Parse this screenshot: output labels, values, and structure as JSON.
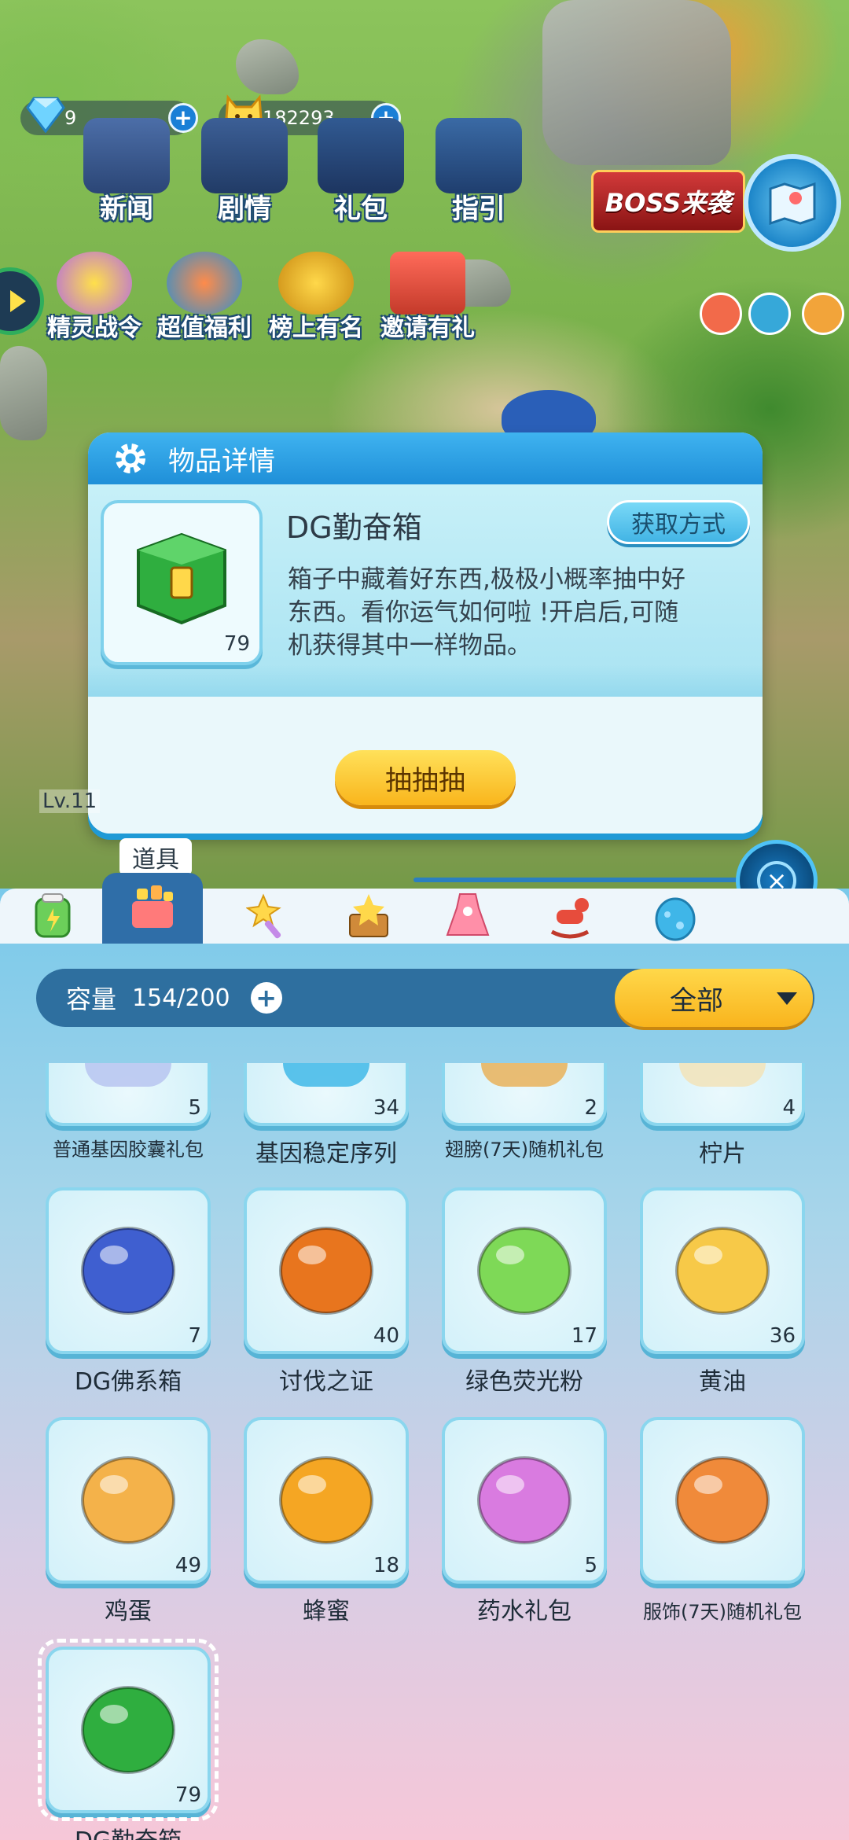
{
  "currency": {
    "gems": "9",
    "coins": "182293",
    "plus": "+"
  },
  "top_menu": [
    {
      "label": "新闻"
    },
    {
      "label": "剧情"
    },
    {
      "label": "礼包"
    },
    {
      "label": "指引"
    }
  ],
  "second_menu": [
    {
      "label": "精灵战令"
    },
    {
      "label": "超值福利"
    },
    {
      "label": "榜上有名"
    },
    {
      "label": "邀请有礼"
    }
  ],
  "boss_banner": "BOSS来袭",
  "dialog": {
    "title": "物品详情",
    "item_name": "DG勤奋箱",
    "item_count": "79",
    "get_button": "获取方式",
    "description": "箱子中藏着好东西,极极小概率抽中好东西。看你运气如何啦 !开启后,可随机获得其中一样物品。",
    "action_button": "抽抽抽"
  },
  "level_tag": "Lv.11",
  "tab_tooltip": "道具",
  "close_icon": "×",
  "bag": {
    "capacity_label": "容量",
    "capacity_value": "154/200",
    "capacity_plus": "+",
    "filter_label": "全部",
    "rows": [
      [
        {
          "name": "普通基因胶囊礼包",
          "count": "5",
          "icon": "gene-capsule-gift-icon",
          "color": "#b7c4f0"
        },
        {
          "name": "基因稳定序列",
          "count": "34",
          "icon": "gene-sequence-icon",
          "color": "#41b8e8"
        },
        {
          "name": "翅膀(7天)随机礼包",
          "count": "2",
          "icon": "wing-gift-icon",
          "color": "#e9b25a"
        },
        {
          "name": "柠片",
          "count": "4",
          "icon": "lemon-slice-icon",
          "color": "#f2e3b8"
        }
      ],
      [
        {
          "name": "DG佛系箱",
          "count": "7",
          "icon": "blue-chest-icon",
          "color": "#3f5fd0"
        },
        {
          "name": "讨伐之证",
          "count": "40",
          "icon": "fire-eye-icon",
          "color": "#e8751e"
        },
        {
          "name": "绿色荧光粉",
          "count": "17",
          "icon": "green-powder-bowl-icon",
          "color": "#7ed957"
        },
        {
          "name": "黄油",
          "count": "36",
          "icon": "cheese-icon",
          "color": "#f7c948"
        }
      ],
      [
        {
          "name": "鸡蛋",
          "count": "49",
          "icon": "egg-icon",
          "color": "#f4b24a"
        },
        {
          "name": "蜂蜜",
          "count": "18",
          "icon": "honeycomb-icon",
          "color": "#f5a623"
        },
        {
          "name": "药水礼包",
          "count": "5",
          "icon": "potion-gift-icon",
          "color": "#d97be0"
        },
        {
          "name": "服饰(7天)随机礼包",
          "count": "",
          "icon": "costume-gift-icon",
          "color": "#f08a3a"
        }
      ],
      [
        {
          "name": "DG勤奋箱",
          "count": "79",
          "icon": "green-chest-icon",
          "color": "#2fae3f"
        }
      ]
    ]
  }
}
